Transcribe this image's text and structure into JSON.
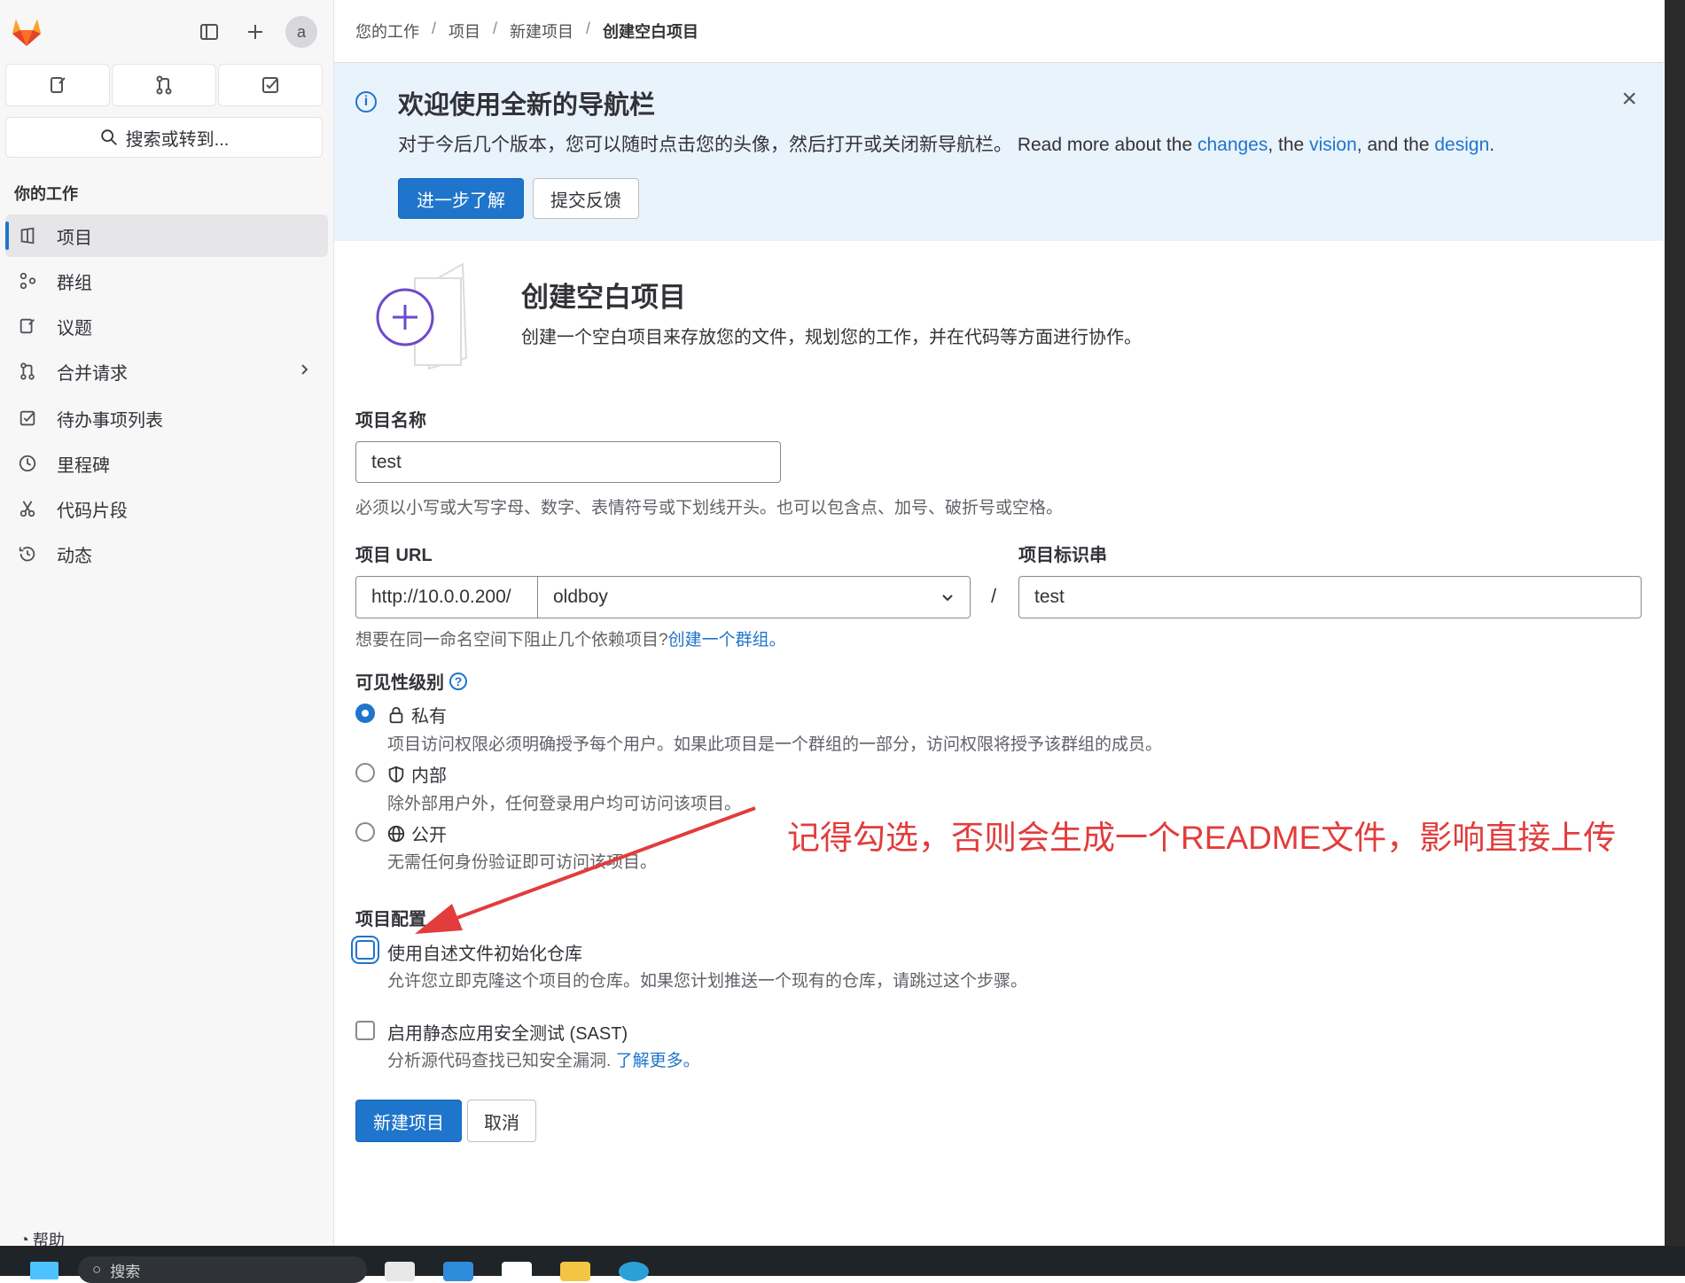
{
  "sidebar": {
    "search_label": "搜索或转到...",
    "avatar_text": "a",
    "section_heading": "你的工作",
    "items": [
      {
        "label": "项目",
        "icon": "project-icon",
        "active": true
      },
      {
        "label": "群组",
        "icon": "group-icon"
      },
      {
        "label": "议题",
        "icon": "issues-icon"
      },
      {
        "label": "合并请求",
        "icon": "merge-request-icon",
        "has_chevron": true
      },
      {
        "label": "待办事项列表",
        "icon": "todo-icon"
      },
      {
        "label": "里程碑",
        "icon": "milestone-icon"
      },
      {
        "label": "代码片段",
        "icon": "snippet-icon"
      },
      {
        "label": "动态",
        "icon": "activity-icon"
      }
    ],
    "help_label": "帮助"
  },
  "breadcrumb": [
    "您的工作",
    "项目",
    "新建项目",
    "创建空白项目"
  ],
  "banner": {
    "title": "欢迎使用全新的导航栏",
    "text_prefix": "对于今后几个版本，您可以随时点击您的头像，然后打开或关闭新导航栏。 Read more about the ",
    "link_changes": "changes",
    "text_mid1": ", the ",
    "link_vision": "vision",
    "text_mid2": ", and the ",
    "link_design": "design",
    "text_end": ".",
    "learn_more_button": "进一步了解",
    "feedback_button": "提交反馈"
  },
  "page": {
    "title": "创建空白项目",
    "description": "创建一个空白项目来存放您的文件，规划您的工作，并在代码等方面进行协作。"
  },
  "form": {
    "name_label": "项目名称",
    "name_value": "test",
    "name_help": "必须以小写或大写字母、数字、表情符号或下划线开头。也可以包含点、加号、破折号或空格。",
    "url_label": "项目 URL",
    "url_prefix": "http://10.0.0.200/",
    "namespace_value": "oldboy",
    "slash": "/",
    "slug_label": "项目标识串",
    "slug_value": "test",
    "group_help_prefix": "想要在同一命名空间下阻止几个依赖项目?",
    "group_help_link": "创建一个群组。",
    "visibility_label": "可见性级别",
    "visibility_help_icon": "?",
    "visibility_options": [
      {
        "label": "私有",
        "icon": "lock-icon",
        "desc": "项目访问权限必须明确授予每个用户。如果此项目是一个群组的一部分，访问权限将授予该群组的成员。",
        "checked": true
      },
      {
        "label": "内部",
        "icon": "shield-icon",
        "desc": "除外部用户外，任何登录用户均可访问该项目。",
        "checked": false
      },
      {
        "label": "公开",
        "icon": "earth-icon",
        "desc": "无需任何身份验证即可访问该项目。",
        "checked": false
      }
    ],
    "config_label": "项目配置",
    "readme_label": "使用自述文件初始化仓库",
    "readme_desc": "允许您立即克隆这个项目的仓库。如果您计划推送一个现有的仓库，请跳过这个步骤。",
    "sast_label": "启用静态应用安全测试 (SAST)",
    "sast_desc_prefix": "分析源代码查找已知安全漏洞. ",
    "sast_link": "了解更多。",
    "create_button": "新建项目",
    "cancel_button": "取消"
  },
  "annotation": "记得勾选，否则会生成一个README文件，影响直接上传",
  "taskbar": {
    "search_placeholder": "搜索"
  },
  "colors": {
    "accent": "#1f75cb",
    "annotation": "#e23c3c",
    "banner_bg": "#e9f3fc"
  }
}
